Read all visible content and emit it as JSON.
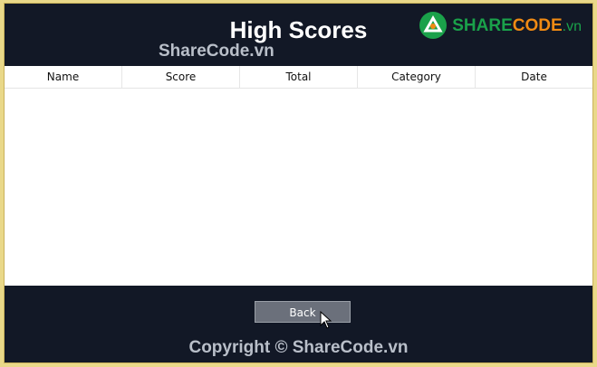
{
  "header": {
    "title": "High Scores",
    "watermark": "ShareCode.vn"
  },
  "logo": {
    "part1": "SHARE",
    "part2": "CODE",
    "part3": ".vn"
  },
  "table": {
    "columns": [
      "Name",
      "Score",
      "Total",
      "Category",
      "Date"
    ],
    "rows": []
  },
  "footer": {
    "back_label": "Back",
    "copyright": "Copyright © ShareCode.vn"
  }
}
